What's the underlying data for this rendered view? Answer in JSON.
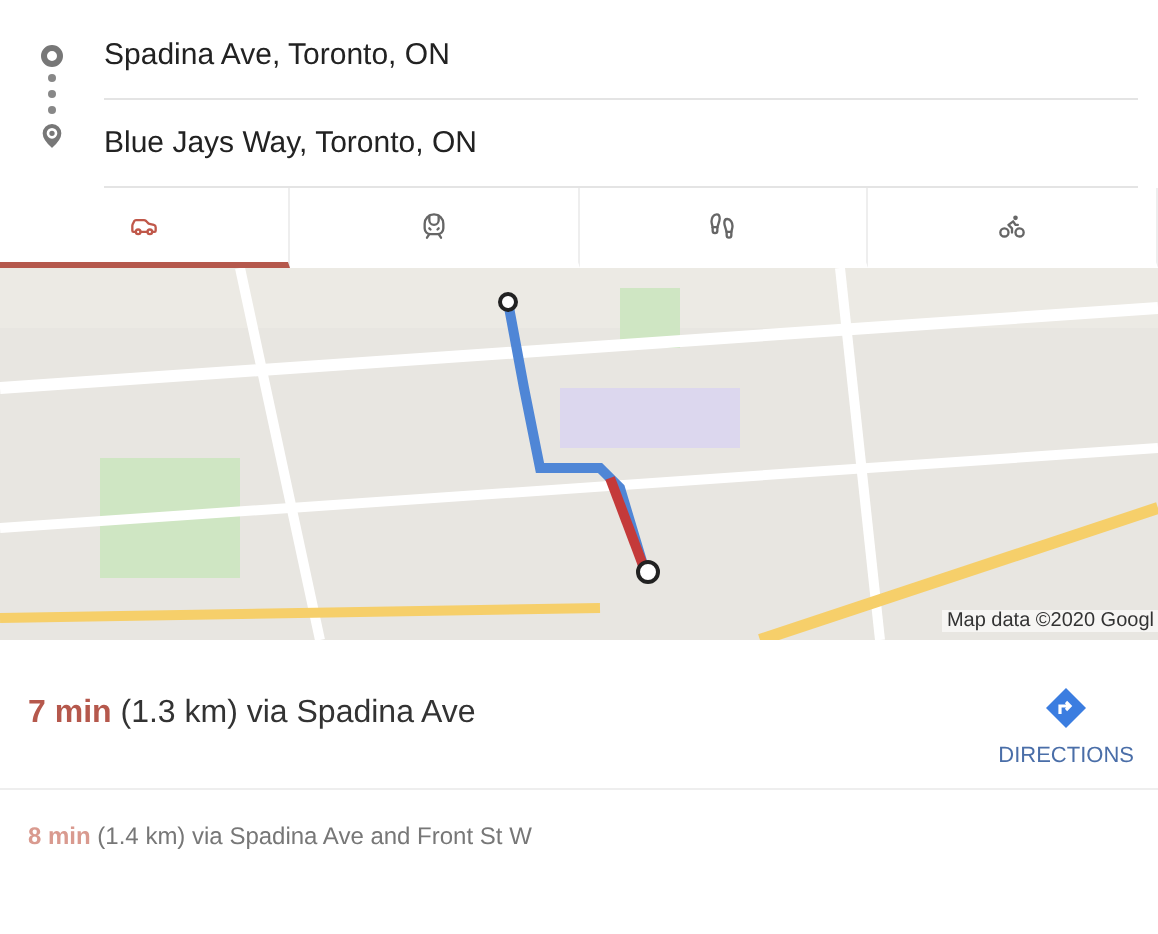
{
  "stops": [
    {
      "kind": "origin",
      "value": "Spadina Ave, Toronto, ON"
    },
    {
      "kind": "destination",
      "value": "Blue Jays Way, Toronto, ON"
    }
  ],
  "modes": [
    {
      "kind": "car",
      "selected": true
    },
    {
      "kind": "transit",
      "selected": false
    },
    {
      "kind": "walk",
      "selected": false
    },
    {
      "kind": "bike",
      "selected": false
    }
  ],
  "map": {
    "kind": "picture",
    "attribution": "Map data ©2020 Googl"
  },
  "routes": [
    {
      "kind": "primary",
      "time": "7 min",
      "detail": "(1.3 km) via Spadina Ave",
      "action": "DIRECTIONS"
    },
    {
      "kind": "alternate",
      "time": "8 min",
      "detail": "(1.4 km) via Spadina Ave and Front St W"
    }
  ]
}
